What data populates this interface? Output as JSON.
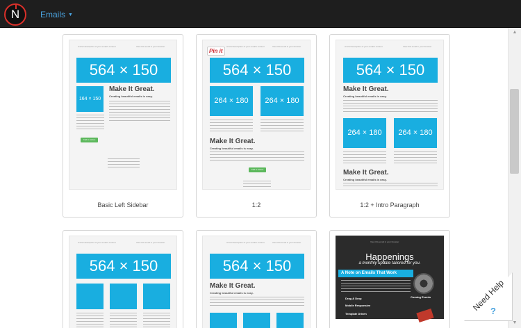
{
  "app": {
    "logo_letter": "N",
    "nav_label": "Emails"
  },
  "cards": [
    {
      "caption": "Basic Left Sidebar",
      "preheader_left": "A brief description of your email's content",
      "preheader_right": "View this email in your browser",
      "hero": "564 × 150",
      "side_box": "164 × 150",
      "heading": "Make It Great.",
      "subheading": "Creating beautiful emails is easy.",
      "button": "Call to Action"
    },
    {
      "caption": "1:2",
      "preheader_left": "A brief description of your email's content",
      "preheader_right": "View this email in your browser",
      "pin_label": "Pin it",
      "hero": "564 × 150",
      "box_a": "264 × 180",
      "box_b": "264 × 180",
      "heading": "Make It Great.",
      "subheading": "Creating beautiful emails is easy.",
      "button": "Call to Action"
    },
    {
      "caption": "1:2 + Intro Paragraph",
      "preheader_left": "A brief description of your email's content",
      "preheader_right": "View this email in your browser",
      "hero": "564 × 150",
      "heading": "Make It Great.",
      "subheading": "Creating beautiful emails is easy.",
      "box_a": "264 × 180",
      "box_b": "264 × 180",
      "heading2": "Make It Great.",
      "subheading2": "Creating beautiful emails is easy."
    },
    {
      "preheader_left": "A brief description of your email's content",
      "preheader_right": "View this email in your browser",
      "hero": "564 × 150"
    },
    {
      "preheader_left": "A brief description of your email's content",
      "preheader_right": "View this email in your browser",
      "hero": "564 × 150",
      "heading": "Make It Great.",
      "subheading": "Creating beautiful emails is easy."
    },
    {
      "preheader": "View this email in your browser",
      "title": "Happenings",
      "subtitle": "a monthly update tailored for you.",
      "section": "A Note on Emails That Work",
      "bullet1": "Drag & Drop",
      "bullet2": "Mobile Responsive",
      "bullet3": "Template Driven",
      "side_label": "Coming Events"
    }
  ],
  "help": {
    "label": "Need Help",
    "icon": "?"
  },
  "colors": {
    "accent": "#19aee0",
    "button": "#5cb85c",
    "topbar": "#1e1e1e",
    "logo": "#d9302a"
  }
}
